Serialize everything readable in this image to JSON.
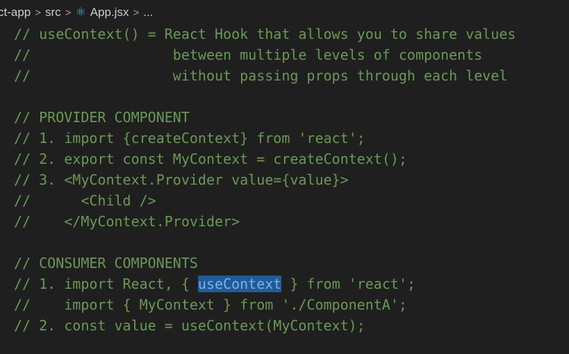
{
  "breadcrumb": {
    "items": [
      "ct-app",
      "src",
      "App.jsx",
      "..."
    ],
    "separator": ">",
    "file_icon": "react-icon"
  },
  "code_lines": [
    [
      "// useContext() = React Hook that allows you to share values"
    ],
    [
      "//                 between multiple levels of components"
    ],
    [
      "//                 without passing props through each level"
    ],
    [
      ""
    ],
    [
      "// PROVIDER COMPONENT"
    ],
    [
      "// 1. import {createContext} from 'react';"
    ],
    [
      "// 2. export const MyContext = createContext();"
    ],
    [
      "// 3. <MyContext.Provider value={value}>"
    ],
    [
      "//      <Child />"
    ],
    [
      "//    </MyContext.Provider>"
    ],
    [
      ""
    ],
    [
      "// CONSUMER COMPONENTS"
    ],
    [
      "// 1. import React, { ",
      "useContext",
      " } from 'react';"
    ],
    [
      "//    import { MyContext } from './ComponentA';"
    ],
    [
      "// 2. const value = useContext(MyContext);"
    ]
  ],
  "selection": {
    "line": 13,
    "text": "useContext"
  },
  "colors": {
    "background": "#1f1f1f",
    "comment": "#6a9955",
    "selection": "#1e5c99"
  }
}
